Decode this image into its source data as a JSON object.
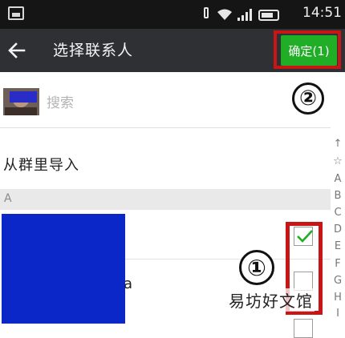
{
  "status_bar": {
    "time": "14:51"
  },
  "app_bar": {
    "title": "选择联系人",
    "confirm_label": "确定(1)"
  },
  "search": {
    "placeholder": "搜索"
  },
  "import_row": {
    "label": "从群里导入"
  },
  "section": {
    "letter": "A"
  },
  "contacts": [
    {
      "name": "",
      "checked": true
    },
    {
      "name": "a",
      "checked": false
    },
    {
      "name": "",
      "checked": false
    }
  ],
  "index_bar": [
    "↑",
    "☆",
    "A",
    "B",
    "C",
    "D",
    "E",
    "F",
    "G",
    "H",
    "I"
  ],
  "annotations": {
    "circle_1": "①",
    "circle_2": "②",
    "highlight_color": "#c81515"
  },
  "watermark": "易坊好文馆",
  "colors": {
    "confirm_green": "#1fae25",
    "app_bar": "#2f3033",
    "redaction_blue": "#0b27c8"
  }
}
